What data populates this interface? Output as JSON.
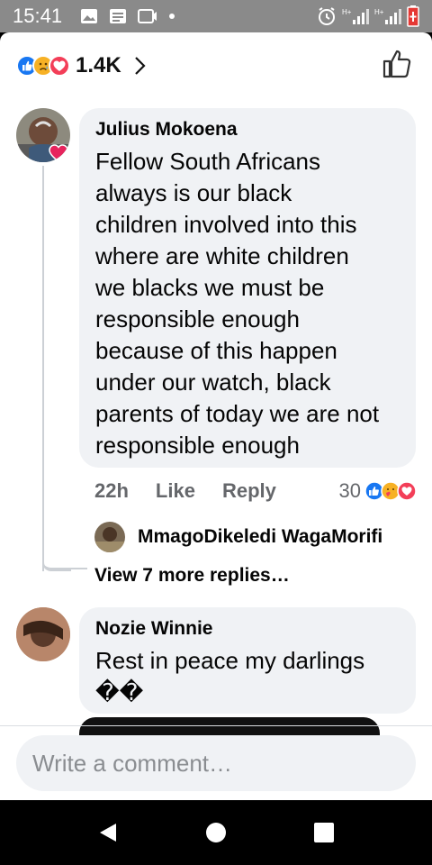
{
  "status_bar": {
    "time": "15:41"
  },
  "reactions": {
    "icons": [
      "like-icon",
      "sad-icon",
      "love-icon"
    ],
    "count": "1.4K"
  },
  "comments": [
    {
      "author": "Julius Mokoena",
      "text_lines": [
        "Fellow South Africans",
        "always is our black",
        "children involved into this",
        "where are white children",
        "we blacks we must be",
        "responsible enough",
        "because of this happen",
        "under our watch, black",
        "parents of today we are not",
        "responsible enough"
      ],
      "time": "22h",
      "like_label": "Like",
      "reply_label": "Reply",
      "reaction_count": "30",
      "reply_preview_author": "MmagoDikeledi WagaMorifi",
      "more_replies": "View 7 more replies…"
    },
    {
      "author": "Nozie Winnie",
      "text_lines": [
        "Rest in peace my darlings",
        "��"
      ]
    }
  ],
  "compose": {
    "placeholder": "Write a comment…"
  },
  "colors": {
    "like_blue": "#1877f2",
    "love_red": "#f33e58",
    "sad_yellow": "#f7b125",
    "bubble_bg": "#f0f2f5",
    "meta_gray": "#65676b"
  }
}
